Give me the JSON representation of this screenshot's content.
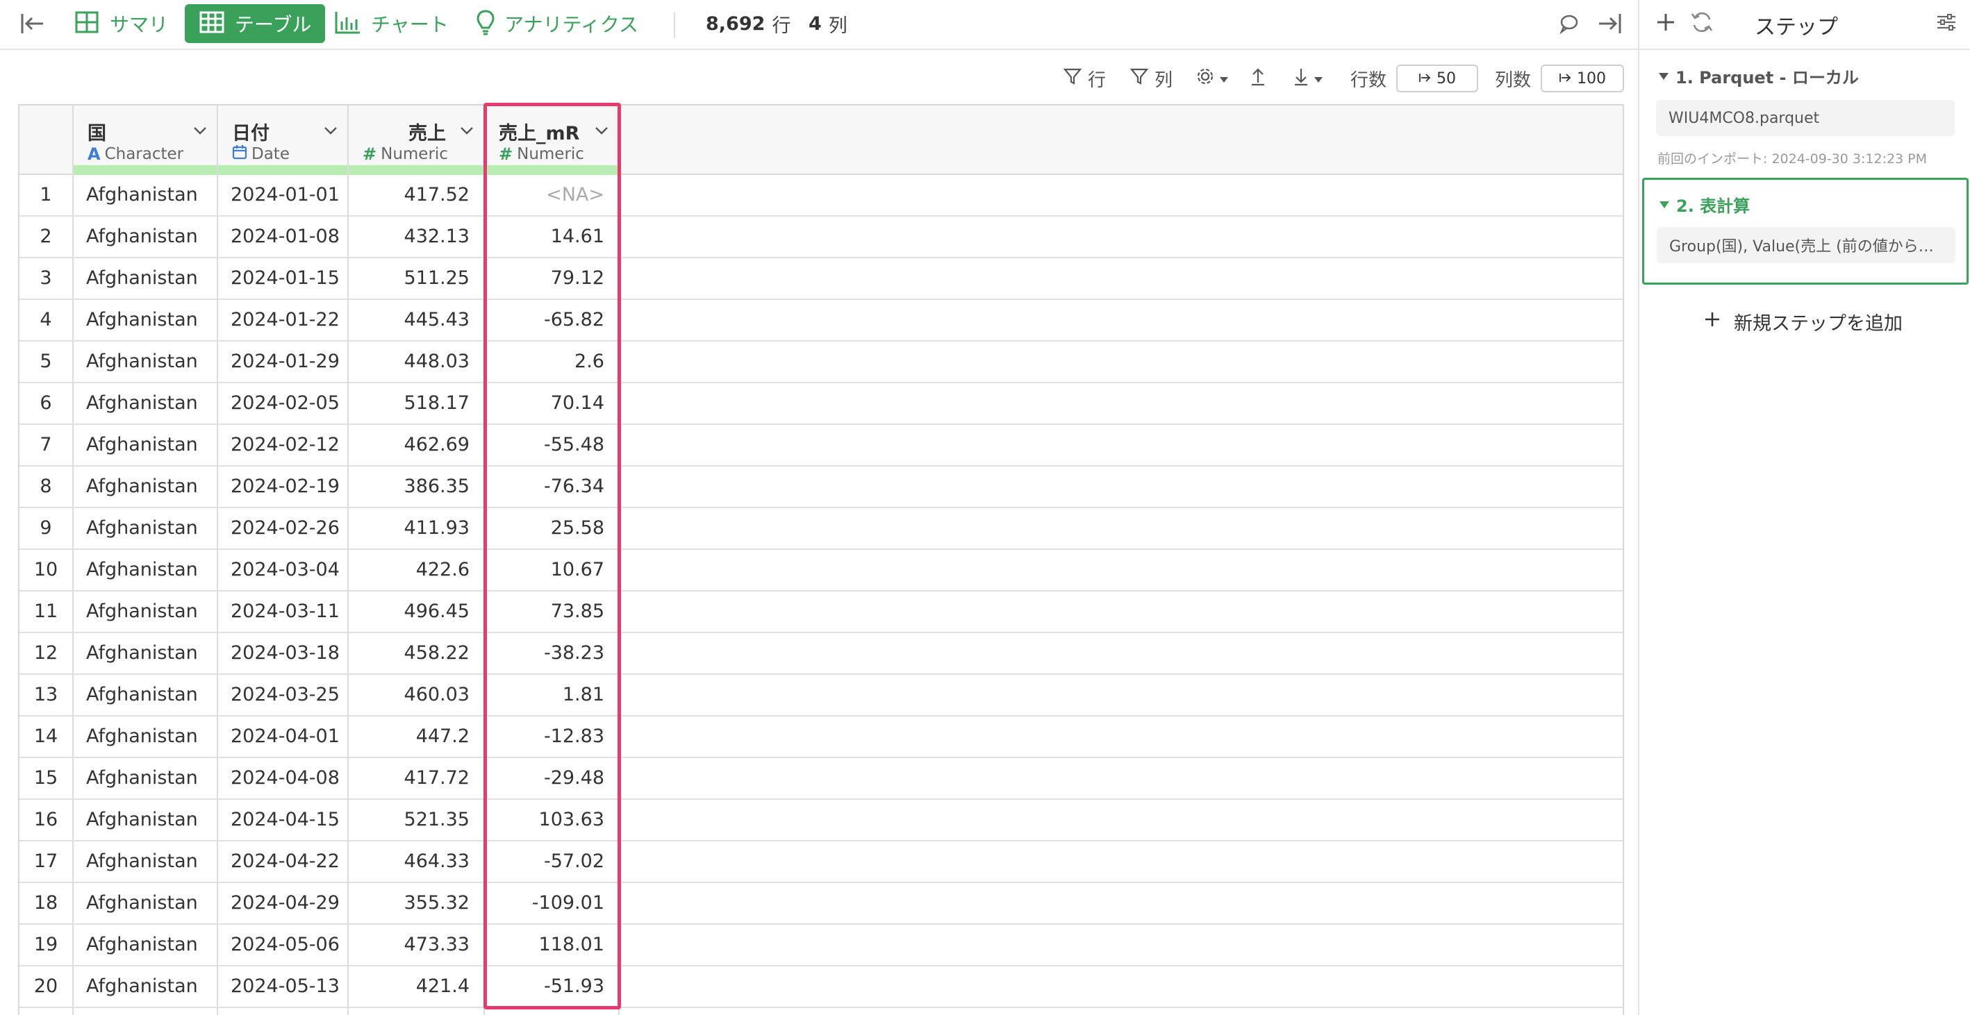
{
  "toolbar": {
    "tabs": [
      {
        "label": "サマリ",
        "icon": "summary-grid-icon",
        "active": false
      },
      {
        "label": "テーブル",
        "icon": "table-icon",
        "active": true
      },
      {
        "label": "チャート",
        "icon": "bar-chart-icon",
        "active": false
      },
      {
        "label": "アナリティクス",
        "icon": "lightbulb-icon",
        "active": false
      }
    ],
    "row_count": "8,692",
    "row_unit": "行",
    "col_count": "4",
    "col_unit": "列"
  },
  "table_toolbar": {
    "filter_rows_label": "行",
    "filter_cols_label": "列",
    "rows_label": "行数",
    "rows_limit": "50",
    "cols_label": "列数",
    "cols_limit": "100"
  },
  "table": {
    "columns": [
      {
        "name": "国",
        "type": "Character",
        "type_icon": "character-type-icon"
      },
      {
        "name": "日付",
        "type": "Date",
        "type_icon": "calendar-icon"
      },
      {
        "name": "売上",
        "type": "Numeric",
        "type_icon": "hash-icon"
      },
      {
        "name": "売上_mR",
        "type": "Numeric",
        "type_icon": "hash-icon"
      }
    ],
    "rows": [
      [
        "1",
        "Afghanistan",
        "2024-01-01",
        "417.52",
        "<NA>"
      ],
      [
        "2",
        "Afghanistan",
        "2024-01-08",
        "432.13",
        "14.61"
      ],
      [
        "3",
        "Afghanistan",
        "2024-01-15",
        "511.25",
        "79.12"
      ],
      [
        "4",
        "Afghanistan",
        "2024-01-22",
        "445.43",
        "-65.82"
      ],
      [
        "5",
        "Afghanistan",
        "2024-01-29",
        "448.03",
        "2.6"
      ],
      [
        "6",
        "Afghanistan",
        "2024-02-05",
        "518.17",
        "70.14"
      ],
      [
        "7",
        "Afghanistan",
        "2024-02-12",
        "462.69",
        "-55.48"
      ],
      [
        "8",
        "Afghanistan",
        "2024-02-19",
        "386.35",
        "-76.34"
      ],
      [
        "9",
        "Afghanistan",
        "2024-02-26",
        "411.93",
        "25.58"
      ],
      [
        "10",
        "Afghanistan",
        "2024-03-04",
        "422.6",
        "10.67"
      ],
      [
        "11",
        "Afghanistan",
        "2024-03-11",
        "496.45",
        "73.85"
      ],
      [
        "12",
        "Afghanistan",
        "2024-03-18",
        "458.22",
        "-38.23"
      ],
      [
        "13",
        "Afghanistan",
        "2024-03-25",
        "460.03",
        "1.81"
      ],
      [
        "14",
        "Afghanistan",
        "2024-04-01",
        "447.2",
        "-12.83"
      ],
      [
        "15",
        "Afghanistan",
        "2024-04-08",
        "417.72",
        "-29.48"
      ],
      [
        "16",
        "Afghanistan",
        "2024-04-15",
        "521.35",
        "103.63"
      ],
      [
        "17",
        "Afghanistan",
        "2024-04-22",
        "464.33",
        "-57.02"
      ],
      [
        "18",
        "Afghanistan",
        "2024-04-29",
        "355.32",
        "-109.01"
      ],
      [
        "19",
        "Afghanistan",
        "2024-05-06",
        "473.33",
        "118.01"
      ],
      [
        "20",
        "Afghanistan",
        "2024-05-13",
        "421.4",
        "-51.93"
      ]
    ]
  },
  "panel": {
    "title": "ステップ",
    "steps": [
      {
        "title": "1. Parquet - ローカル",
        "body": "WIU4MCO8.parquet",
        "note": "前回のインポート: 2024-09-30 3:12:23 PM"
      },
      {
        "title": "2. 表計算",
        "body": "Group(国), Value(売上 (前の値から…"
      }
    ],
    "add_step_label": "新規ステップを追加"
  },
  "colors": {
    "accent_green": "#3aa15b",
    "highlight_border": "#e23d6c",
    "header_bar": "#b9ecb3"
  }
}
